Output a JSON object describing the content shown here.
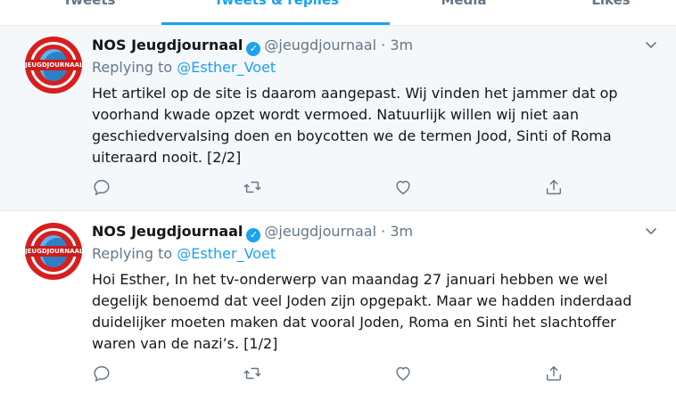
{
  "tabs": [
    {
      "label": "Tweets"
    },
    {
      "label": "Tweets & replies"
    },
    {
      "label": "Media"
    },
    {
      "label": "Likes"
    }
  ],
  "tweets": [
    {
      "name": "NOS Jeugdjournaal",
      "handle": "@jeugdjournaal",
      "dot": "·",
      "time": "3m",
      "replying_prefix": "Replying to",
      "replying_to": "@Esther_Voet",
      "avatar_text": "JEUGDJOURNAAL",
      "text": "Het artikel op de site is daarom aangepast. Wij vinden het jammer dat op voorhand kwade opzet wordt vermoed. Natuurlijk willen wij niet aan geschiedvervalsing doen en boycotten we de termen Jood, Sinti of Roma uiteraard nooit. [2/2]"
    },
    {
      "name": "NOS Jeugdjournaal",
      "handle": "@jeugdjournaal",
      "dot": "·",
      "time": "3m",
      "replying_prefix": "Replying to",
      "replying_to": "@Esther_Voet",
      "avatar_text": "JEUGDJOURNAAL",
      "text": "Hoi Esther, In het tv-onderwerp van maandag 27 januari hebben we wel degelijk benoemd dat veel Joden zijn opgepakt. Maar we hadden inderdaad duidelijker moeten maken dat vooral Joden, Roma en Sinti het slachtoffer waren van de nazi’s. [1/2]"
    }
  ],
  "icons": {
    "reply": "reply-icon",
    "retweet": "retweet-icon",
    "like": "heart-icon",
    "share": "share-icon",
    "menu": "chevron-down-icon",
    "verified": "verified-badge-icon"
  },
  "colors": {
    "accent": "#1da1f2",
    "secondary_text": "#657786",
    "highlight_bg": "#f5f8fa"
  }
}
